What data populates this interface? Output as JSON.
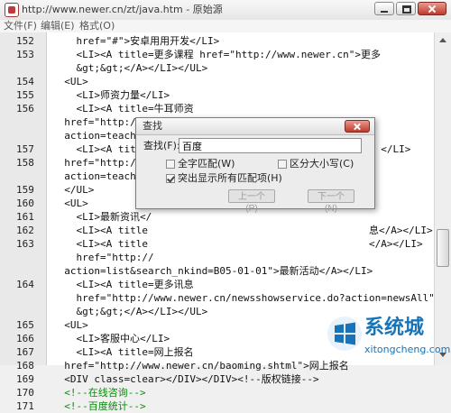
{
  "window": {
    "title": "http://www.newer.cn/zt/java.htm - 原始源",
    "icon": "app-icon",
    "controls": {
      "minimize": "minimize-icon",
      "maximize": "maximize-icon",
      "close": "close-icon"
    }
  },
  "menu": {
    "file": "文件(F)",
    "edit": "编辑(E)",
    "format": "格式(O)"
  },
  "code_lines": [
    {
      "ln": "152",
      "text": "    href=\"#\">安卓用用开发</LI>"
    },
    {
      "ln": "153",
      "text": "    <LI><A title=更多课程 href=\"http://www.newer.cn\">更多"
    },
    {
      "ln": "",
      "text": "    &gt;&gt;</A></LI></UL>"
    },
    {
      "ln": "154",
      "text": "  <UL>"
    },
    {
      "ln": "155",
      "text": "    <LI>师资力量</LI>"
    },
    {
      "ln": "156",
      "text": "    <LI><A title=牛耳师资"
    },
    {
      "ln": "",
      "text": "  href=\"http://www.newer.cn/newsshowservice.do?"
    },
    {
      "ln": "",
      "text": "  action=teacher"
    },
    {
      "ln": "157",
      "text": "    <LI><A title                                       </LI>"
    },
    {
      "ln": "158",
      "text": "  href=\"http://w"
    },
    {
      "ln": "",
      "text": "  action=teacher"
    },
    {
      "ln": "159",
      "text": "  </UL>"
    },
    {
      "ln": "160",
      "text": "  <UL>"
    },
    {
      "ln": "161",
      "text": "    <LI>最新资讯</"
    },
    {
      "ln": "162",
      "text": "    <LI><A title                                     息</A></LI>"
    },
    {
      "ln": "163",
      "text": "    <LI><A title                                     </A></LI>"
    },
    {
      "ln": "",
      "text": "    href=\"http://                                "
    },
    {
      "ln": "",
      "text": "  action=list&search_nkind=B05-01-01\">最新活动</A></LI>"
    },
    {
      "ln": "164",
      "text": "    <LI><A title=更多讯息"
    },
    {
      "ln": "",
      "text": "    href=\"http://www.newer.cn/newsshowservice.do?action=newsAll\">更多"
    },
    {
      "ln": "",
      "text": "    &gt;&gt;</A></LI></UL>"
    },
    {
      "ln": "165",
      "text": "  <UL>"
    },
    {
      "ln": "166",
      "text": "    <LI>客服中心</LI>"
    },
    {
      "ln": "167",
      "text": "    <LI><A title=网上报名"
    },
    {
      "ln": "168",
      "text": "  href=\"http://www.newer.cn/baoming.shtml\">网上报名"
    },
    {
      "ln": "169",
      "text": "  <DIV class=clear></DIV></DIV><!--版权链接-->"
    },
    {
      "ln": "170",
      "text": "  <!--在线咨询-->"
    },
    {
      "ln": "171",
      "text": "  <!--百度统计-->"
    }
  ],
  "find_dialog": {
    "title": "查找",
    "label": "查找(F):",
    "value": "百度",
    "whole_word": {
      "label": "全字匹配(W)",
      "checked": false
    },
    "match_case": {
      "label": "区分大小写(C)",
      "checked": false
    },
    "highlight_all": {
      "label": "突出显示所有匹配项(H)",
      "checked": true
    },
    "prev_button": "上一个(P)",
    "next_button": "下一个(N)"
  },
  "watermark": {
    "brand": "系统城",
    "url": "xitongcheng.com",
    "logo": "windows-logo-icon"
  },
  "colors": {
    "comment": "#0a8a0a",
    "brand": "#1874b8",
    "close_button": "#c0392b"
  }
}
